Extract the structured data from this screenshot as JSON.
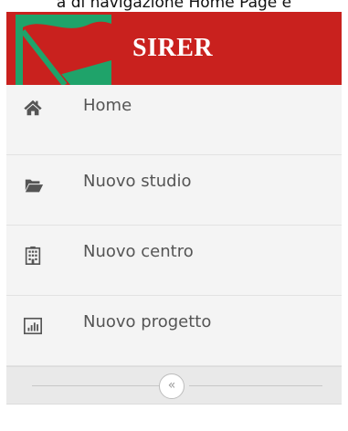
{
  "caption": {
    "text": "a di navigazione Home Page e"
  },
  "header": {
    "brand": "SIRER",
    "background_color": "#c9211e",
    "logo_accent_color": "#1fa36a"
  },
  "menu": {
    "items": [
      {
        "label": "Home",
        "icon": "home-icon"
      },
      {
        "label": "Nuovo studio",
        "icon": "folder-open-icon"
      },
      {
        "label": "Nuovo centro",
        "icon": "building-icon"
      },
      {
        "label": "Nuovo progetto",
        "icon": "bar-chart-icon"
      }
    ]
  },
  "collapse": {
    "label": "«",
    "icon": "double-chevron-left-icon"
  }
}
